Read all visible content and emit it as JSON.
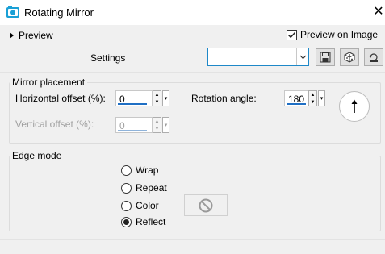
{
  "window": {
    "title": "Rotating Mirror",
    "close_glyph": "✕",
    "icon": "app-icon"
  },
  "preview": {
    "toggle_label": "Preview",
    "preview_on_image_label": "Preview on Image",
    "preview_on_image_checked": true
  },
  "settings": {
    "label": "Settings",
    "combo_value": "",
    "buttons": [
      "save-icon",
      "randomize-icon",
      "reset-icon"
    ]
  },
  "mirror_placement": {
    "legend": "Mirror placement",
    "horizontal_offset_label": "Horizontal offset (%):",
    "horizontal_offset_value": "0",
    "vertical_offset_label": "Vertical offset (%):",
    "vertical_offset_value": "0",
    "vertical_offset_enabled": false,
    "rotation_angle_label": "Rotation angle:",
    "rotation_angle_value": "180"
  },
  "edge_mode": {
    "legend": "Edge mode",
    "options": [
      {
        "label": "Wrap",
        "selected": false
      },
      {
        "label": "Repeat",
        "selected": false
      },
      {
        "label": "Color",
        "selected": false
      },
      {
        "label": "Reflect",
        "selected": true
      }
    ]
  },
  "colors": {
    "accent": "#1f6fc4",
    "focus_border": "#1e88c8",
    "app_icon": "#1aa0d6"
  }
}
